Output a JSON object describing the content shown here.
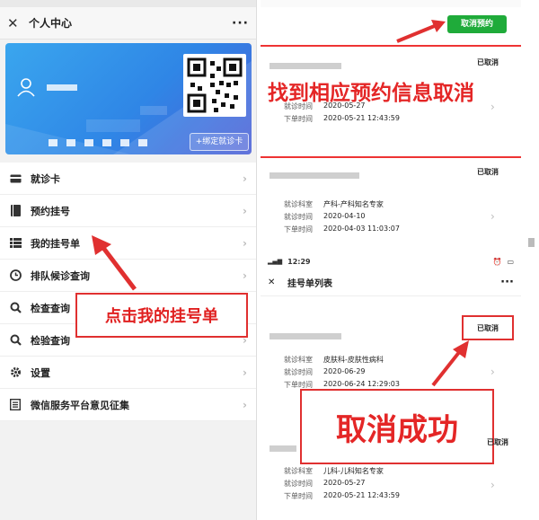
{
  "left": {
    "title": "个人中心",
    "more": "···",
    "close": "✕",
    "bind_card": "+绑定就诊卡",
    "menu": [
      {
        "label": "就诊卡",
        "icon": "card-icon"
      },
      {
        "label": "预约挂号",
        "icon": "book-icon"
      },
      {
        "label": "我的挂号单",
        "icon": "list-icon"
      },
      {
        "label": "排队候诊查询",
        "icon": "clock-icon"
      },
      {
        "label": "检查查询",
        "icon": "search-icon"
      },
      {
        "label": "检验查询",
        "icon": "search-icon"
      },
      {
        "label": "设置",
        "icon": "gear-icon"
      },
      {
        "label": "微信服务平台意见征集",
        "icon": "doc-icon"
      }
    ],
    "callout": "点击我的挂号单"
  },
  "right_top": {
    "cancel_button": "取消预约",
    "headline": "找到相应预约信息取消",
    "records": [
      {
        "status": "已取消",
        "dept_label": "就诊科室",
        "dept": "",
        "date_label": "就诊时间",
        "date": "2020-05-27",
        "order_label": "下单时间",
        "order": "2020-05-21 12:43:59"
      },
      {
        "status": "已取消",
        "dept_label": "就诊科室",
        "dept": "产科-产科知名专家",
        "date_label": "就诊时间",
        "date": "2020-04-10",
        "order_label": "下单时间",
        "order": "2020-04-03 11:03:07"
      }
    ]
  },
  "right_bottom": {
    "time": "12:29",
    "title": "挂号单列表",
    "more": "···",
    "close": "✕",
    "headline": "取消成功",
    "records": [
      {
        "status": "已取消",
        "dept_label": "就诊科室",
        "dept": "皮肤科-皮肤性病科",
        "date_label": "就诊时间",
        "date": "2020-06-29",
        "order_label": "下单时间",
        "order": "2020-06-24 12:29:03"
      },
      {
        "status": "已取消",
        "dept_label": "就诊科室",
        "dept": "儿科-儿科知名专家",
        "date_label": "就诊时间",
        "date": "2020-05-27",
        "order_label": "下单时间",
        "order": "2020-05-21 12:43:59"
      }
    ]
  },
  "colors": {
    "accent_red": "#e42626",
    "cancel_green": "#1fab3a",
    "card_blue": "#2f86e6"
  }
}
